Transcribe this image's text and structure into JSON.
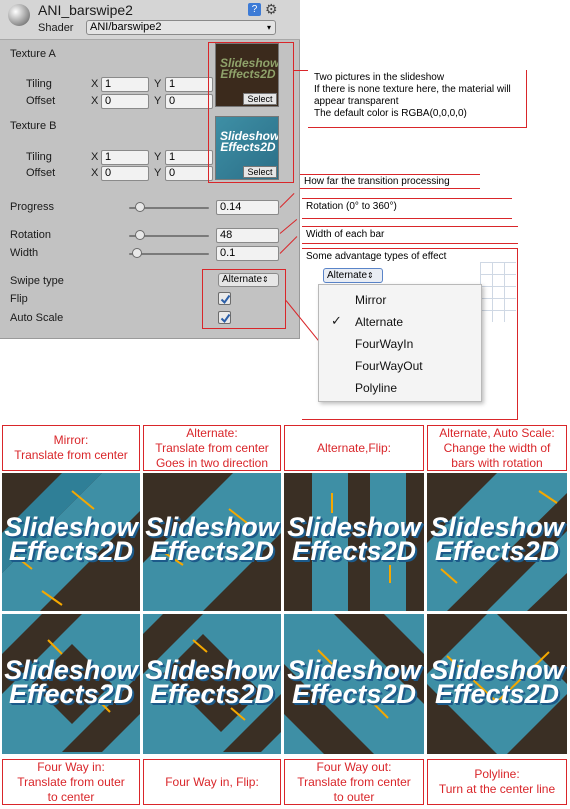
{
  "inspector": {
    "title": "ANI_barswipe2",
    "shader_label": "Shader",
    "shader_value": "ANI/barswipe2",
    "texture_a": {
      "label": "Texture A",
      "tiling_label": "Tiling",
      "offset_label": "Offset",
      "tiling_x": "1",
      "tiling_y": "1",
      "offset_x": "0",
      "offset_y": "0",
      "select_label": "Select"
    },
    "texture_b": {
      "label": "Texture B",
      "tiling_label": "Tiling",
      "offset_label": "Offset",
      "tiling_x": "1",
      "tiling_y": "1",
      "offset_x": "0",
      "offset_y": "0",
      "select_label": "Select"
    },
    "x_label": "X",
    "y_label": "Y",
    "progress": {
      "label": "Progress",
      "value": "0.14",
      "fraction": 0.14
    },
    "rotation": {
      "label": "Rotation",
      "value": "48",
      "fraction": 0.133
    },
    "width": {
      "label": "Width",
      "value": "0.1",
      "fraction": 0.1
    },
    "swipe_type": {
      "label": "Swipe type",
      "value": "Alternate"
    },
    "flip": {
      "label": "Flip",
      "checked": true
    },
    "auto_scale": {
      "label": "Auto Scale",
      "checked": true
    },
    "logo_line1": "Slideshow",
    "logo_line2": "Effects2D"
  },
  "callouts": {
    "textures": [
      "Two pictures in the slideshow",
      "If there is none texture here, the material will",
      "appear transparent",
      "The default color is RGBA(0,0,0,0)"
    ],
    "progress": "How far the transition processing",
    "rotation": "Rotation (0° to 360°)",
    "width": "Width of each bar",
    "swipe": "Some advantage types of effect"
  },
  "dropdown": {
    "button_label": "Alternate",
    "options": [
      "Mirror",
      "Alternate",
      "FourWayIn",
      "FourWayOut",
      "Polyline"
    ],
    "selected_index": 1
  },
  "examples_top": [
    {
      "line1": "Mirror:",
      "line2": "Translate from center",
      "line3": ""
    },
    {
      "line1": "Alternate:",
      "line2": "Translate from center",
      "line3": "Goes in two direction"
    },
    {
      "line1": "Alternate,Flip:",
      "line2": "",
      "line3": ""
    },
    {
      "line1": "Alternate, Auto Scale:",
      "line2": "Change the width of",
      "line3": "bars with rotation"
    }
  ],
  "examples_bottom": [
    {
      "line1": "Four Way in:",
      "line2": "Translate from outer",
      "line3": "to center"
    },
    {
      "line1": "Four Way in, Flip:",
      "line2": "",
      "line3": ""
    },
    {
      "line1": "Four Way out:",
      "line2": "Translate from center",
      "line3": "to outer"
    },
    {
      "line1": "Polyline:",
      "line2": "Turn at the center line",
      "line3": ""
    }
  ],
  "colors": {
    "callout_red": "#d9262a",
    "arrow_orange": "#f5a800",
    "teal": "#3e8fa5",
    "dark_brown": "#3a2f24"
  }
}
